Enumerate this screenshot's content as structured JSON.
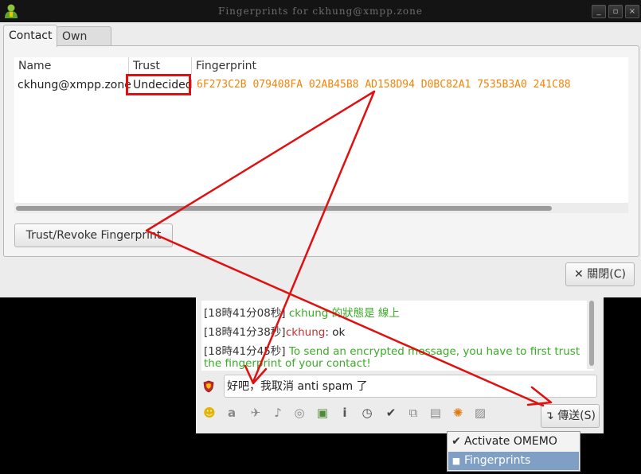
{
  "dialog": {
    "title": "Fingerprints for ckhung@xmpp.zone",
    "tabs": [
      {
        "label": "Contact"
      },
      {
        "label": "Own Devices"
      }
    ],
    "table": {
      "columns": [
        "Name",
        "Trust",
        "Fingerprint"
      ],
      "rows": [
        {
          "name": "ckhung@xmpp.zone",
          "trust": "Undecided",
          "fingerprint": "6F273C2B 079408FA 02AB45B8 AD158D94 D0BC82A1 7535B3A0 241C88"
        }
      ]
    },
    "trust_button": "Trust/Revoke Fingerprint",
    "close_button": "關閉(C)"
  },
  "chat": {
    "log": [
      {
        "time": "[18時41分08秒]",
        "text": "ckhung 的狀態是 線上"
      },
      {
        "time": "[18時41分38秒]",
        "nick": "ckhung",
        "text": ": ok"
      },
      {
        "time": "[18時41分45秒]",
        "text": "To send an encrypted message, you have to first trust",
        "text2": "the fingerprint of your contact!"
      }
    ],
    "input_value": "好吧，我取消 anti spam 了",
    "send_button": "傳送(S)"
  },
  "menu": {
    "items": [
      {
        "label": "Activate OMEMO",
        "checked": true
      },
      {
        "label": "Fingerprints",
        "selected": true
      }
    ]
  },
  "colors": {
    "fingerprint": "#f0850a",
    "status_green": "#3aab26",
    "annotation_red": "#e01010",
    "menu_highlight": "#7f9fc4"
  }
}
